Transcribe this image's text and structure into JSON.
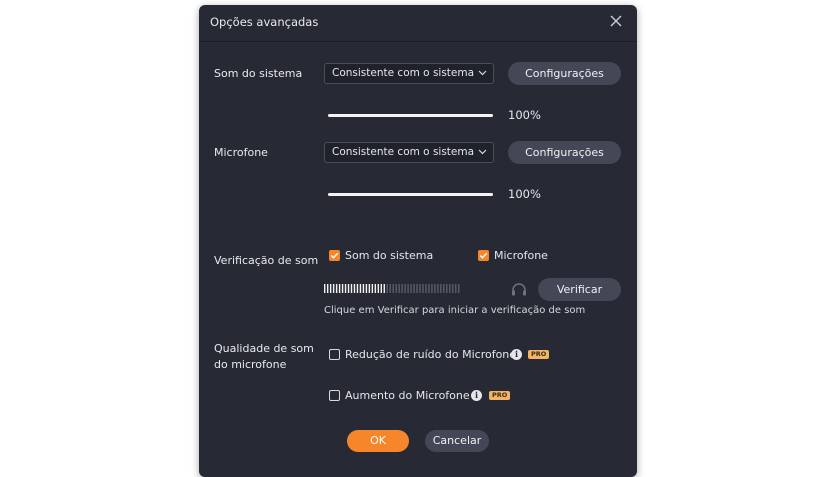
{
  "dialog": {
    "title": "Opções avançadas",
    "system_sound": {
      "label": "Som do sistema",
      "select_value": "Consistente com o sistema",
      "settings_label": "Configurações",
      "volume": 1.0,
      "volume_text": "100%"
    },
    "microphone": {
      "label": "Microfone",
      "select_value": "Consistente com o sistema",
      "settings_label": "Configurações",
      "volume": 1.0,
      "volume_text": "100%"
    },
    "sound_check": {
      "label": "Verificação de som",
      "system_sound_label": "Som do sistema",
      "system_sound_checked": true,
      "microphone_label": "Microfone",
      "microphone_checked": true,
      "level": 0.45,
      "verify_label": "Verificar",
      "hint": "Clique em Verificar para iniciar a verificação de som"
    },
    "mic_quality": {
      "label_line1": "Qualidade de som",
      "label_line2": "do microfone",
      "noise_reduction_label": "Redução de ruído do Microfone",
      "noise_reduction_checked": false,
      "boost_label": "Aumento do Microfone",
      "boost_checked": false,
      "info_glyph": "i",
      "pro_badge": "PRO"
    },
    "ok_label": "OK",
    "cancel_label": "Cancelar"
  },
  "colors": {
    "dialog_bg": "#272a35",
    "accent": "#f7862a",
    "button_bg": "#444856",
    "pro_badge": "#f3b467"
  },
  "icons": {
    "close": "close-icon",
    "dropdown": "chevron-down-icon",
    "headphones": "headphones-icon",
    "info": "info-icon",
    "check": "check-icon"
  }
}
